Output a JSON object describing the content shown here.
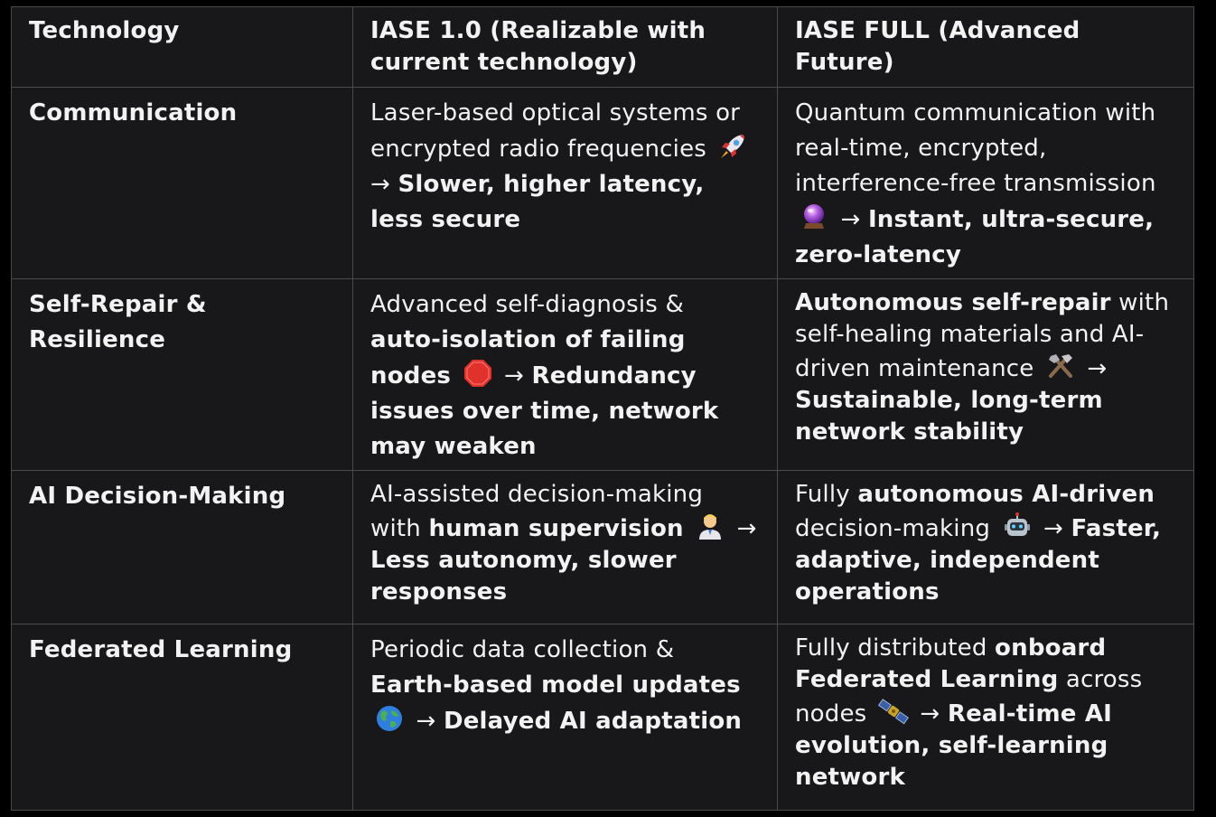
{
  "table": {
    "headers": [
      "Technology",
      "IASE 1.0 (Realizable with current technology)",
      "IASE FULL (Advanced Future)"
    ],
    "rows": [
      {
        "technology": "Communication",
        "v1": {
          "text": "Laser-based optical systems or encrypted radio frequencies",
          "emoji": "rocket-icon",
          "arrow": "→",
          "bold": "Slower, higher latency, less secure"
        },
        "full": {
          "text": "Quantum communication with real-time, encrypted, interference-free transmission",
          "emoji": "crystal-ball-icon",
          "arrow": "→",
          "bold": "Instant, ultra-secure, zero-latency"
        }
      },
      {
        "technology": "Self-Repair & Resilience",
        "v1": {
          "text": "Advanced self-diagnosis &",
          "bold_inline": "auto-isolation of failing nodes",
          "emoji": "stop-sign-icon",
          "arrow": "→",
          "bold": "Redundancy issues over time, network may weaken"
        },
        "full": {
          "bold_lead": "Autonomous self-repair",
          "text": "with self-healing materials and AI-driven maintenance",
          "emoji": "tools-icon",
          "arrow": "→",
          "bold": "Sustainable, long-term network stability"
        }
      },
      {
        "technology": "AI Decision-Making",
        "v1": {
          "text": "AI-assisted decision-making with",
          "bold_inline": "human supervision",
          "emoji": "person-icon",
          "arrow": "→",
          "bold": "Less autonomy, slower responses"
        },
        "full": {
          "text_lead": "Fully",
          "bold_inline": "autonomous AI-driven",
          "text": "decision-making",
          "emoji": "robot-icon",
          "arrow": "→",
          "bold": "Faster, adaptive, independent operations"
        }
      },
      {
        "technology": "Federated Learning",
        "v1": {
          "text": "Periodic data collection &",
          "bold_inline": "Earth-based model updates",
          "emoji": "globe-icon",
          "arrow": "→",
          "bold": "Delayed AI adaptation"
        },
        "full": {
          "text_lead": "Fully distributed",
          "bold_inline": "onboard Federated Learning",
          "text": "across nodes",
          "emoji": "satellite-icon",
          "arrow": "→",
          "bold": "Real-time AI evolution, self-learning network"
        }
      }
    ]
  }
}
